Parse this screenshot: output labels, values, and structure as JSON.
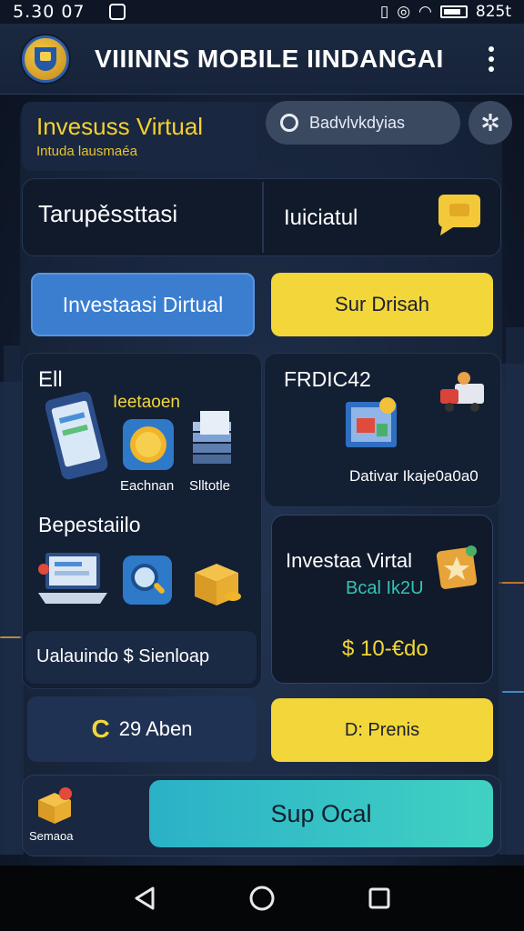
{
  "status_bar": {
    "time": "5.30 07",
    "right_text": "825t"
  },
  "app_bar": {
    "title": "VIIINNS MOBILE IINDANGAI"
  },
  "header": {
    "title": "Invesuss Virtual",
    "subtitle": "Intuda lausmaéa",
    "search_text": "Badvlvkdyias"
  },
  "row1": {
    "left_label": "Tarupěssttasi",
    "right_label": "Ιuiciatul"
  },
  "buttons": {
    "blue": "Investaasi Dirtual",
    "yellow": "Sur Drisah"
  },
  "mid_left": {
    "section1_title": "Ell",
    "section1_label": "Ieetaoen",
    "item1_label": "Eachnan",
    "item2_label": "Slltotle",
    "section2_title": "Bepestaiilo",
    "footer": "Ualauindo  $  Sienloap"
  },
  "mid_right": {
    "title": "FRDIC42",
    "label": "Dativar Ikaje0a0a0"
  },
  "promo": {
    "title": "Investaa Virtal",
    "subtitle": "Bcal Ik2U",
    "price": "$ 10-€do"
  },
  "bottom": {
    "dark_label": "29 Aben",
    "dark_icon_glyph": "C",
    "yellow_label": "D: Prenis"
  },
  "bottom_bar": {
    "service_label": "Semaoa",
    "cta_label": "Sup Ocal"
  },
  "colors": {
    "accent_yellow": "#f3d63a",
    "accent_blue": "#3b7ed0",
    "cta_teal": "#33c1c5",
    "background": "#0f1829"
  }
}
